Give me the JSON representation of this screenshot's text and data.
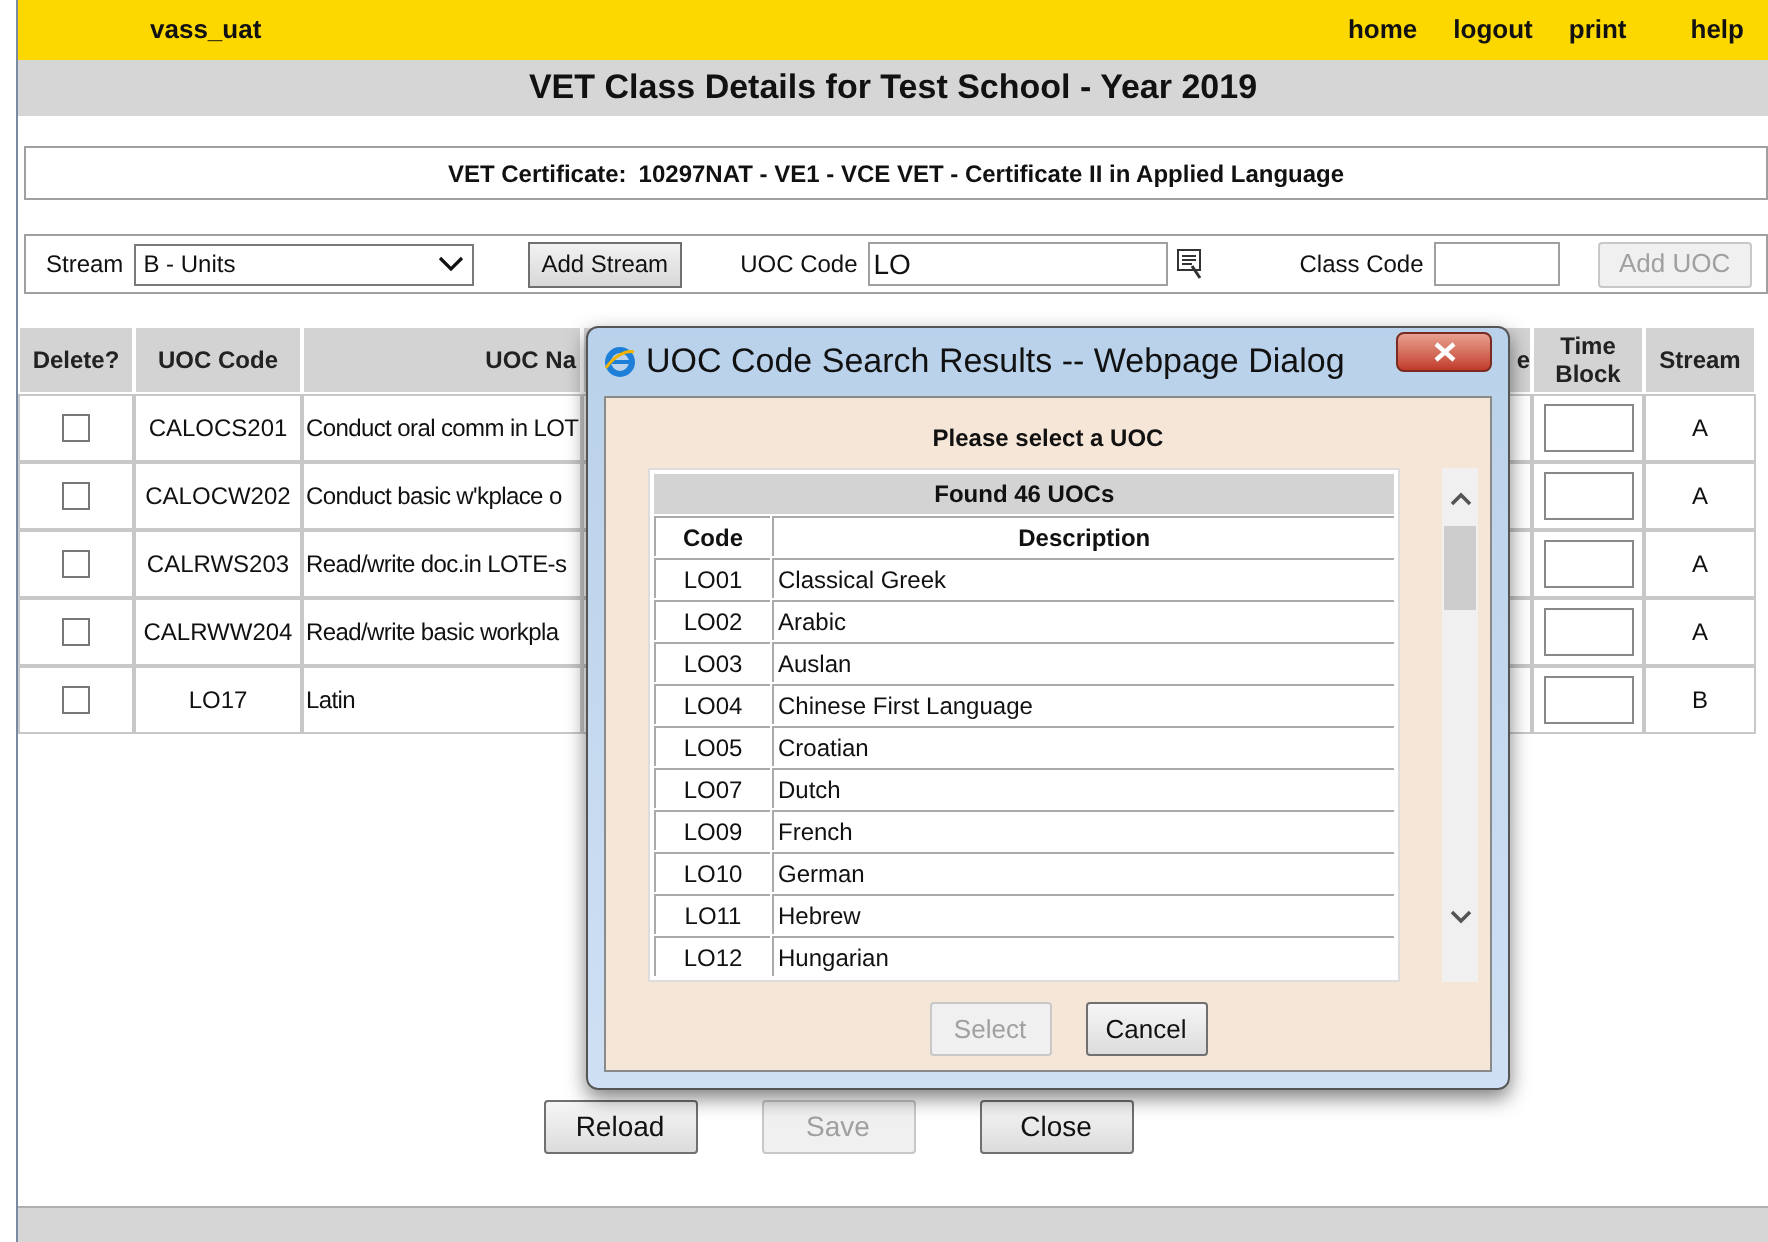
{
  "top_bar": {
    "user": "vass_uat",
    "links": [
      "home",
      "logout",
      "print",
      "help"
    ]
  },
  "title": "VET Class Details for Test School - Year 2019",
  "certificate": {
    "label": "VET Certificate:",
    "value": "10297NAT - VE1 - VCE VET - Certificate II in Applied Language"
  },
  "filter": {
    "stream_label": "Stream",
    "stream_value": "B - Units",
    "add_stream": "Add Stream",
    "uoc_label": "UOC Code",
    "uoc_value": "LO",
    "class_label": "Class Code",
    "add_uoc": {
      "label": "Add UOC",
      "disabled": true
    }
  },
  "table": {
    "columns": [
      "Delete?",
      "UOC Code",
      "UOC Na",
      "e",
      "Time Block",
      "Stream"
    ],
    "rows": [
      {
        "checked": false,
        "code": "CALOCS201",
        "name": "Conduct oral comm in LOT",
        "stream": "A"
      },
      {
        "checked": false,
        "code": "CALOCW202",
        "name": "Conduct basic w'kplace o",
        "stream": "A"
      },
      {
        "checked": false,
        "code": "CALRWS203",
        "name": "Read/write doc.in LOTE-s",
        "stream": "A"
      },
      {
        "checked": false,
        "code": "CALRWW204",
        "name": "Read/write basic workpla",
        "stream": "A"
      },
      {
        "checked": false,
        "code": "LO17",
        "name": "Latin",
        "stream": "B"
      }
    ]
  },
  "buttons": [
    {
      "label": "Reload",
      "disabled": false
    },
    {
      "label": "Save",
      "disabled": true
    },
    {
      "label": "Close",
      "disabled": false
    }
  ],
  "dialog": {
    "title": "UOC Code Search Results -- Webpage Dialog",
    "prompt": "Please select a UOC",
    "found": "Found 46 UOCs",
    "columns": [
      "Code",
      "Description"
    ],
    "rows": [
      {
        "code": "LO01",
        "description": "Classical Greek"
      },
      {
        "code": "LO02",
        "description": "Arabic"
      },
      {
        "code": "LO03",
        "description": "Auslan"
      },
      {
        "code": "LO04",
        "description": "Chinese First Language"
      },
      {
        "code": "LO05",
        "description": "Croatian"
      },
      {
        "code": "LO07",
        "description": "Dutch"
      },
      {
        "code": "LO09",
        "description": "French"
      },
      {
        "code": "LO10",
        "description": "German"
      },
      {
        "code": "LO11",
        "description": "Hebrew"
      },
      {
        "code": "LO12",
        "description": "Hungarian"
      }
    ],
    "buttons": [
      {
        "label": "Select",
        "disabled": true
      },
      {
        "label": "Cancel",
        "disabled": false
      }
    ]
  }
}
